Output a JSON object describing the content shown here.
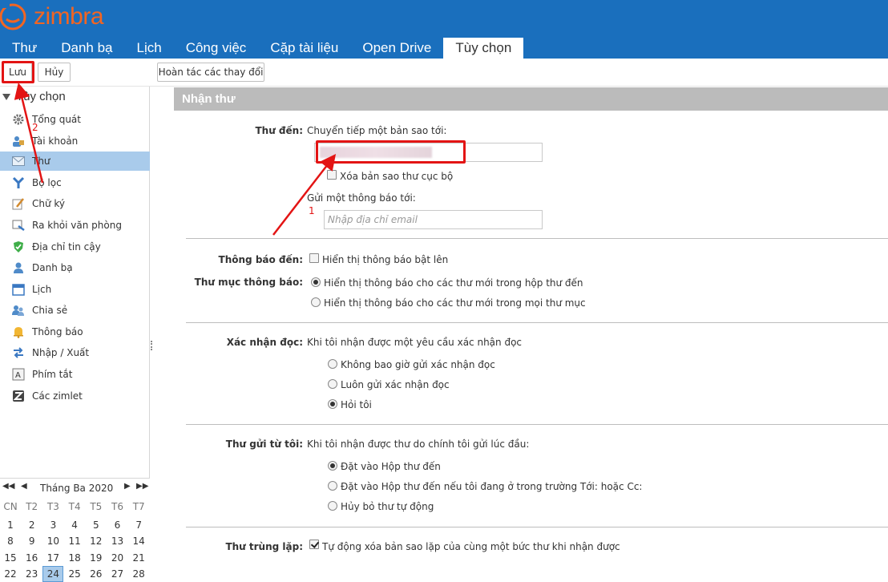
{
  "app": {
    "logo_text": "zimbra",
    "brand_color": "#f26522",
    "topbar_color": "#1a6fbd"
  },
  "tabs": [
    {
      "label": "Thư"
    },
    {
      "label": "Danh bạ"
    },
    {
      "label": "Lịch"
    },
    {
      "label": "Công việc"
    },
    {
      "label": "Cặp tài liệu"
    },
    {
      "label": "Open Drive"
    },
    {
      "label": "Tùy chọn",
      "active": true
    }
  ],
  "toolbar": {
    "save_label": "Lưu",
    "cancel_label": "Hủy",
    "revert_label": "Hoàn tác các thay đổi"
  },
  "sidebar": {
    "heading": "Tùy chọn",
    "items": [
      {
        "label": "Tổng quát",
        "icon": "gear-icon"
      },
      {
        "label": "Tài khoản",
        "icon": "account-icon"
      },
      {
        "label": "Thư",
        "icon": "envelope-icon",
        "selected": true
      },
      {
        "label": "Bộ lọc",
        "icon": "filter-icon"
      },
      {
        "label": "Chữ ký",
        "icon": "signature-icon"
      },
      {
        "label": "Ra khỏi văn phòng",
        "icon": "out-of-office-icon"
      },
      {
        "label": "Địa chỉ tin cậy",
        "icon": "shield-check-icon"
      },
      {
        "label": "Danh bạ",
        "icon": "contact-icon"
      },
      {
        "label": "Lịch",
        "icon": "calendar-icon"
      },
      {
        "label": "Chia sẻ",
        "icon": "share-icon"
      },
      {
        "label": "Thông báo",
        "icon": "bell-icon"
      },
      {
        "label": "Nhập / Xuất",
        "icon": "import-export-icon"
      },
      {
        "label": "Phím tắt",
        "icon": "keyboard-shortcut-icon"
      },
      {
        "label": "Các zimlet",
        "icon": "zimlet-icon"
      }
    ]
  },
  "calendar": {
    "title": "Tháng Ba 2020",
    "days_of_week": [
      "CN",
      "T2",
      "T3",
      "T4",
      "T5",
      "T6",
      "T7"
    ],
    "weeks": [
      [
        "1",
        "2",
        "3",
        "4",
        "5",
        "6",
        "7"
      ],
      [
        "8",
        "9",
        "10",
        "11",
        "12",
        "13",
        "14"
      ],
      [
        "15",
        "16",
        "17",
        "18",
        "19",
        "20",
        "21"
      ],
      [
        "22",
        "23",
        "24",
        "25",
        "26",
        "27",
        "28"
      ]
    ],
    "today": "24"
  },
  "main": {
    "section_title": "Nhận thư",
    "arrival": {
      "label": "Thư đến:",
      "forward_text": "Chuyển tiếp một bản sao tới:",
      "delete_local_copy": "Xóa bản sao thư cục bộ",
      "notify_text": "Gửi một thông báo tới:",
      "email_placeholder": "Nhập địa chỉ email"
    },
    "notify": {
      "label": "Thông báo đến:",
      "show_popup": "Hiển thị thông báo bật lên"
    },
    "notify_folder": {
      "label": "Thư mục thông báo:",
      "opt1": "Hiển thị thông báo cho các thư mới trong hộp thư đến",
      "opt2": "Hiển thị thông báo cho các thư mới trong mọi thư mục"
    },
    "read_receipt": {
      "label": "Xác nhận đọc:",
      "intro": "Khi tôi nhận được một yêu cầu xác nhận đọc",
      "opt1": "Không bao giờ gửi xác nhận đọc",
      "opt2": "Luôn gửi xác nhận đọc",
      "opt3": "Hỏi tôi"
    },
    "from_me": {
      "label": "Thư gửi từ tôi:",
      "intro": "Khi tôi nhận được thư do chính tôi gửi lúc đầu:",
      "opt1": "Đặt vào Hộp thư đến",
      "opt2": "Đặt vào Hộp thư đến nếu tôi đang ở trong trường Tới: hoặc Cc:",
      "opt3": "Hủy bỏ thư tự động"
    },
    "duplicates": {
      "label": "Thư trùng lặp:",
      "text": "Tự động xóa bản sao lặp của cùng một bức thư khi nhận được"
    }
  },
  "annotations": {
    "step1": "1",
    "step2": "2",
    "color": "#e31414"
  }
}
